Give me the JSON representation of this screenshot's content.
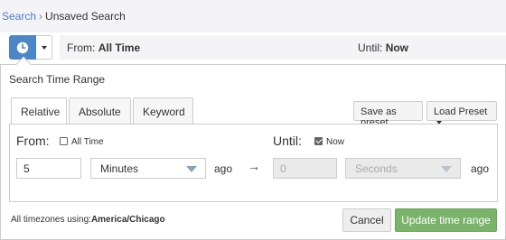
{
  "breadcrumb": {
    "root": "Search",
    "separator": "›",
    "current": "Unsaved Search"
  },
  "toolbar": {
    "from_label": "From:",
    "from_value": "All Time",
    "until_label": "Until:",
    "until_value": "Now",
    "icons": {
      "time": "clock-icon",
      "menu": "caret-down-icon"
    }
  },
  "panel": {
    "title": "Search Time Range",
    "tabs": [
      {
        "label": "Relative",
        "active": true
      },
      {
        "label": "Absolute",
        "active": false
      },
      {
        "label": "Keyword",
        "active": false
      }
    ],
    "save_preset": "Save as preset",
    "load_preset": "Load Preset",
    "from": {
      "label": "From:",
      "checkbox_label": "All Time",
      "checked": false,
      "amount": "5",
      "unit": "Minutes",
      "ago": "ago"
    },
    "arrow": "→",
    "until": {
      "label": "Until:",
      "checkbox_label": "Now",
      "checked": true,
      "amount_placeholder": "0",
      "unit": "Seconds",
      "ago": "ago"
    },
    "timezone_prefix": "All timezones using:",
    "timezone": "America/Chicago",
    "cancel": "Cancel",
    "update": "Update time range"
  },
  "colors": {
    "accent": "#4a86c8",
    "primary_button": "#7ab36a",
    "link": "#4a7dc3"
  }
}
